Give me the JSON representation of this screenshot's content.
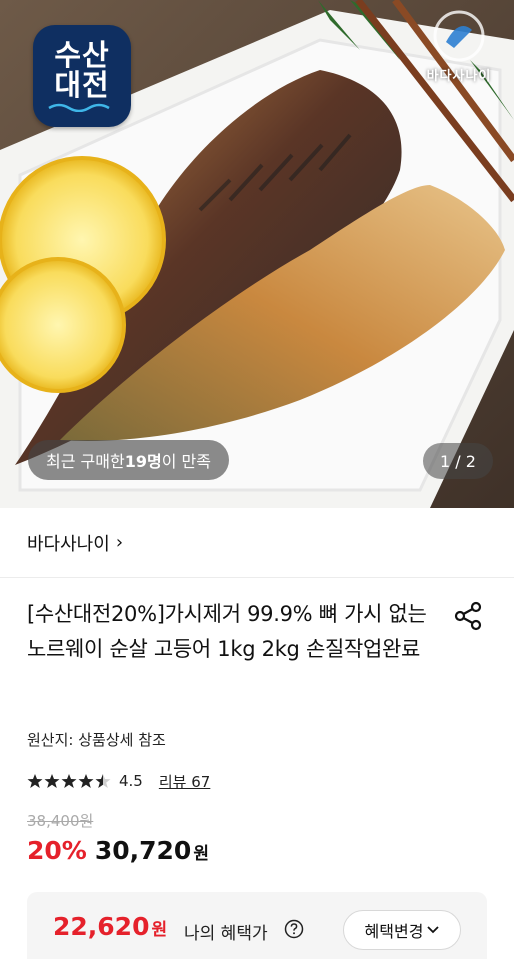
{
  "hero": {
    "logo_line1": "수산",
    "logo_line2": "대전",
    "brand_mark_text": "바다사나이",
    "review_prefix": "최근 구매한 ",
    "review_count": "19명",
    "review_suffix": "이 만족",
    "page_indicator": "1 / 2"
  },
  "store": {
    "name": "바다사나이",
    "chevron": "›"
  },
  "product": {
    "title": "[수산대전20%]가시제거 99.9% 뼈 가시 없는 노르웨이 순살 고등어 1kg 2kg 손질작업완료",
    "origin": "원산지: 상품상세 참조",
    "rating": "4.5",
    "rating_fraction": 0.9,
    "review_link": "리뷰 67",
    "original_price": "38,400원",
    "discount_rate": "20%",
    "sale_price": "30,720",
    "sale_unit": "원"
  },
  "benefit": {
    "price": "22,620",
    "unit": "원",
    "label": "나의 혜택가",
    "change_button": "혜택변경",
    "change_icon": "chevron-down-icon"
  },
  "colors": {
    "accent_red": "#e5212b",
    "logo_navy": "#0f2f61"
  }
}
